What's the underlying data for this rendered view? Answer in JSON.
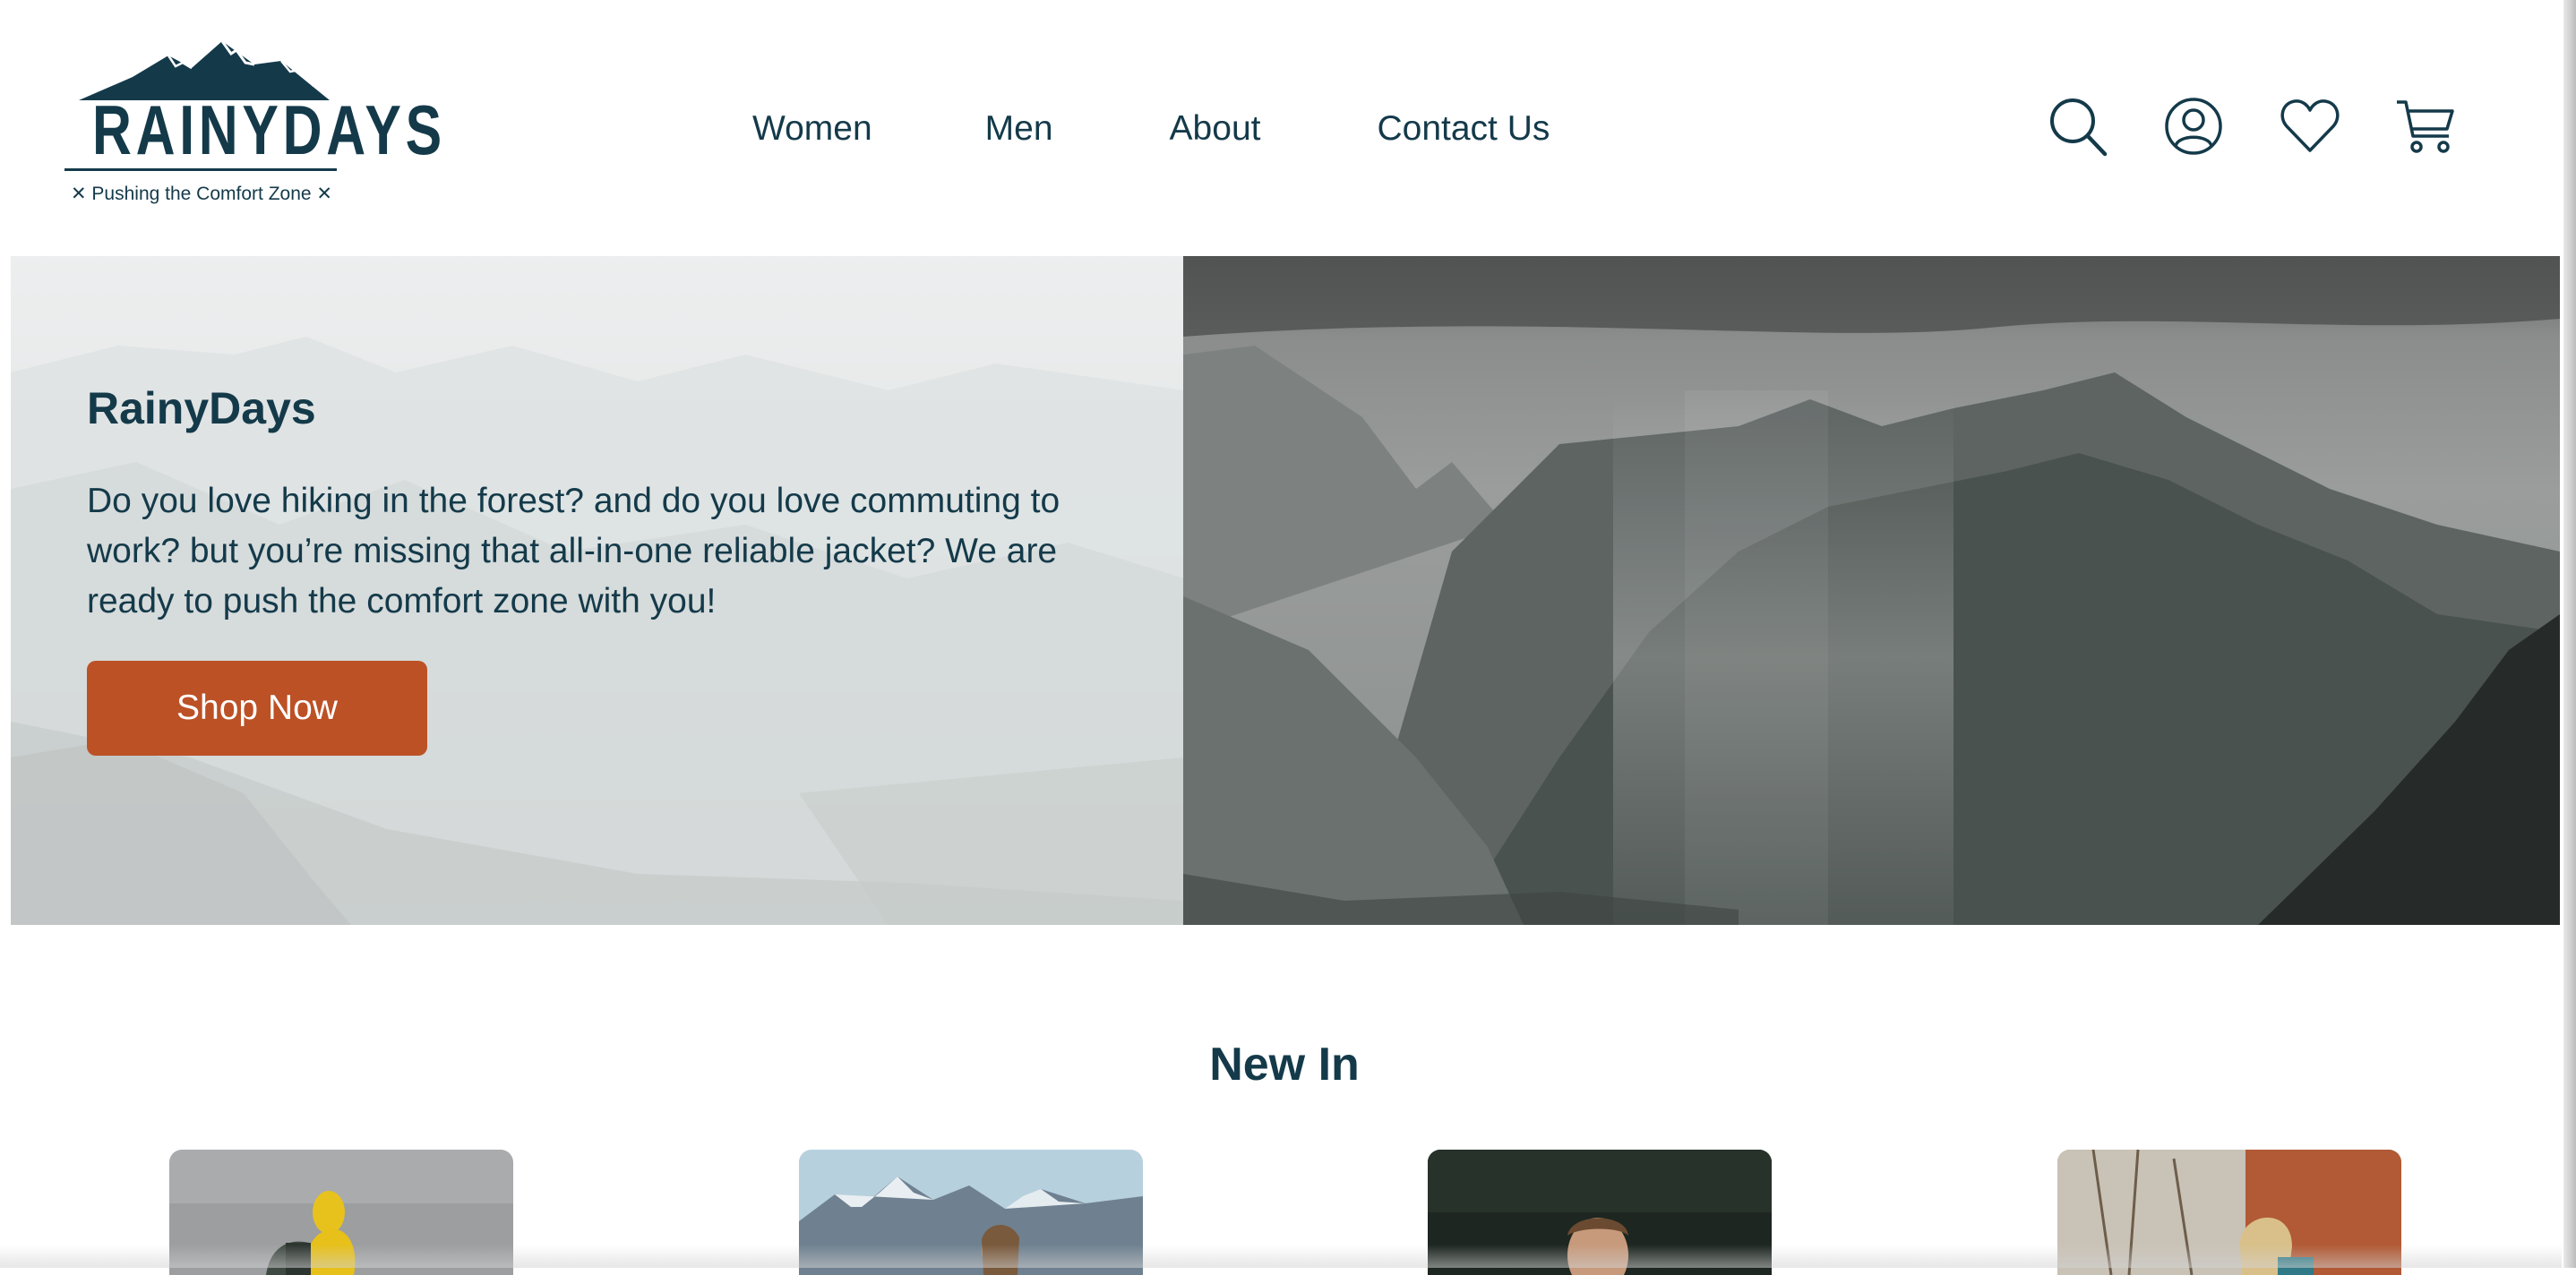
{
  "brand": {
    "name": "RAINYDAYS",
    "tagline": "✕ Pushing the Comfort Zone ✕",
    "color": "#143a4a"
  },
  "nav": {
    "items": [
      {
        "label": "Women"
      },
      {
        "label": "Men"
      },
      {
        "label": "About"
      },
      {
        "label": "Contact Us"
      }
    ]
  },
  "header_icons": [
    "search-icon",
    "account-icon",
    "heart-icon",
    "cart-icon"
  ],
  "hero": {
    "title": "RainyDays",
    "text": "Do you love hiking in the forest? and do you love commuting to work? but you’re missing that all-in-one reliable jacket? We are ready to push the comfort zone with you!",
    "button_label": "Shop Now",
    "button_color": "#bc5126"
  },
  "new_in": {
    "title": "New In",
    "products": [
      {
        "image": "hiker-yellow-jacket"
      },
      {
        "image": "woman-snowy-mountains"
      },
      {
        "image": "man-dark-forest"
      },
      {
        "image": "woman-autumn-rocks"
      }
    ]
  }
}
